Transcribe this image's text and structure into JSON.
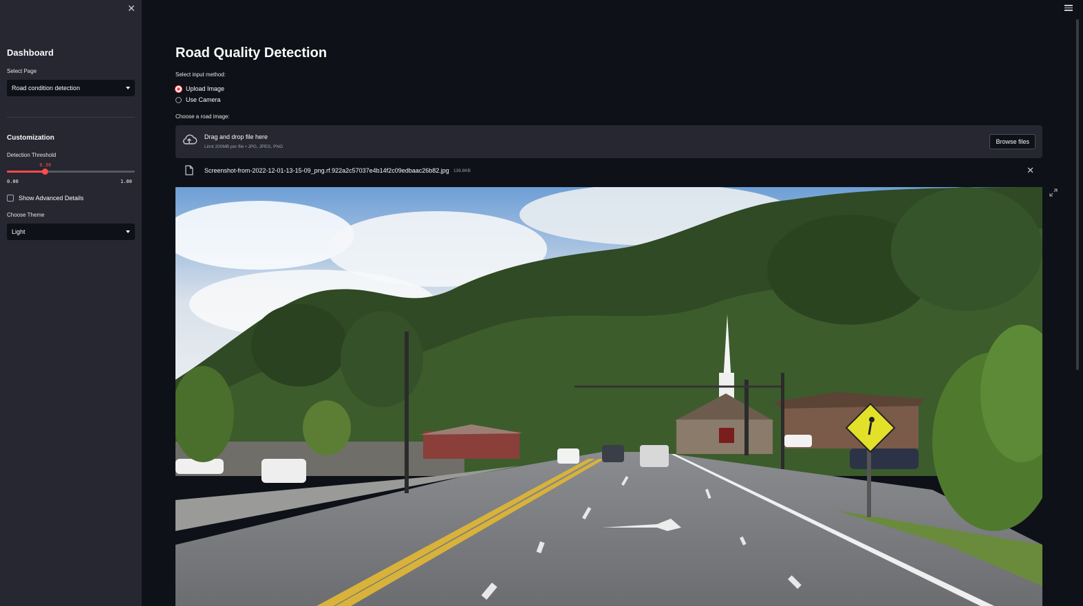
{
  "sidebar": {
    "close_icon": "close-icon",
    "title": "Dashboard",
    "select_page_label": "Select Page",
    "select_page_value": "Road condition detection",
    "customization_heading": "Customization",
    "threshold_label": "Detection Threshold",
    "threshold_value": "0.30",
    "threshold_fraction": 0.3,
    "threshold_min": "0.00",
    "threshold_max": "1.00",
    "advanced_label": "Show Advanced Details",
    "theme_label": "Choose Theme",
    "theme_value": "Light",
    "accent_color": "#ff4b4b"
  },
  "main": {
    "title": "Road Quality Detection",
    "input_method_label": "Select input method:",
    "radio_options": [
      "Upload Image",
      "Use Camera"
    ],
    "selected_option": "Upload Image",
    "choose_label": "Choose a road image:",
    "dropzone_title": "Drag and drop file here",
    "dropzone_sub": "Limit 200MB per file • JPG, JPEG, PNG",
    "browse_label": "Browse files",
    "file_name": "Screenshot-from-2022-12-01-13-15-09_png.rf.922a2c57037e4b14f2c09edbaac26b82.jpg",
    "file_size": "139.8KB",
    "photo_description_icon": "road-image"
  }
}
